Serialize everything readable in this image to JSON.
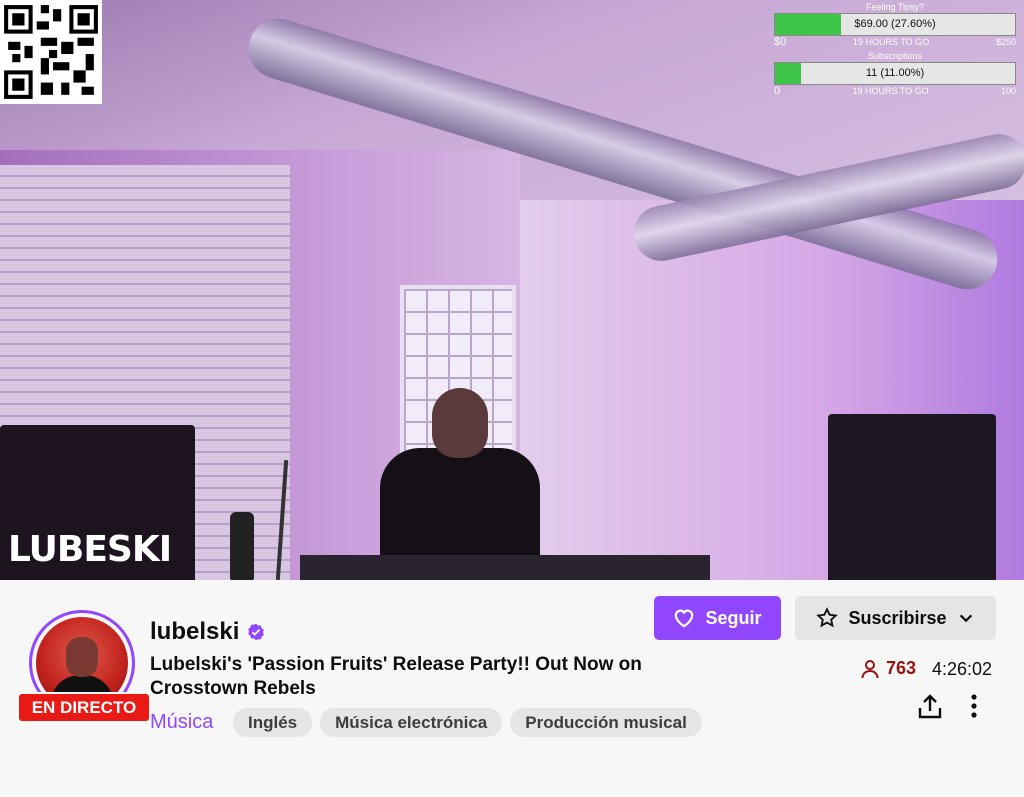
{
  "video": {
    "logo_text": "LUBESKI",
    "goals": [
      {
        "title": "Feeling Tipsy?",
        "text": "$69.00 (27.60%)",
        "progress": 0.276,
        "start": "$0",
        "remaining": "19 HOURS TO GO",
        "end": "$250"
      },
      {
        "title": "Subscriptions",
        "text": "11 (11.00%)",
        "progress": 0.11,
        "start": "0",
        "remaining": "19 HOURS TO GO",
        "end": "100"
      }
    ]
  },
  "channel": {
    "name": "lubelski",
    "live_label": "EN DIRECTO",
    "stream_title": "Lubelski's 'Passion Fruits' Release Party!! Out Now on Crosstown Rebels",
    "category": "Música",
    "tags": [
      "Inglés",
      "Música electrónica",
      "Producción musical"
    ],
    "follow_label": "Seguir",
    "subscribe_label": "Suscribirse",
    "viewers": "763",
    "uptime": "4:26:02"
  },
  "colors": {
    "accent": "#9147ff",
    "live": "#e91916",
    "viewers": "#971311",
    "goal_fill": "#3ec54a"
  },
  "icons": [
    "qr-code-icon",
    "verified-icon",
    "heart-icon",
    "star-icon",
    "chevron-down-icon",
    "person-icon",
    "share-icon",
    "more-vertical-icon"
  ]
}
